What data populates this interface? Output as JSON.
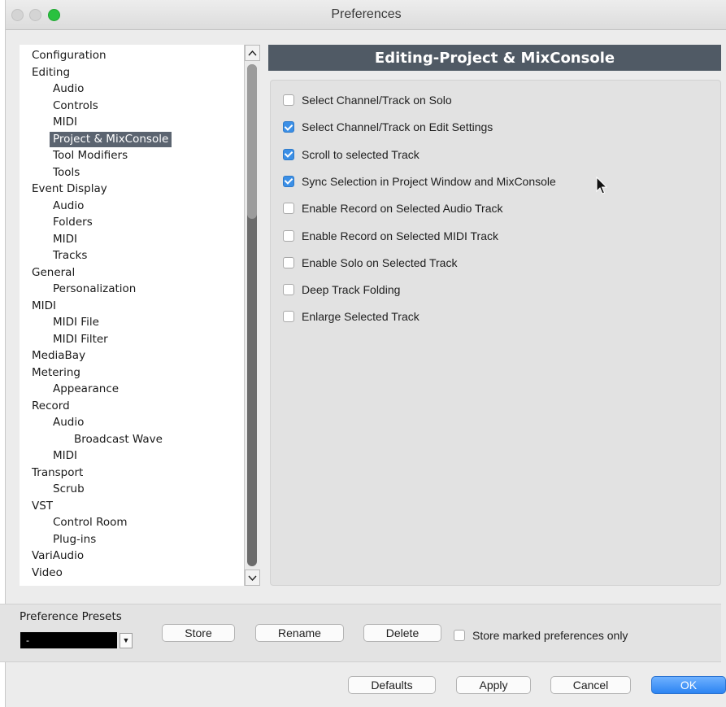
{
  "window": {
    "title": "Preferences"
  },
  "tree": {
    "items": [
      {
        "label": "Configuration",
        "level": 0
      },
      {
        "label": "Editing",
        "level": 0
      },
      {
        "label": "Audio",
        "level": 1
      },
      {
        "label": "Controls",
        "level": 1
      },
      {
        "label": "MIDI",
        "level": 1
      },
      {
        "label": "Project & MixConsole",
        "level": 1,
        "selected": true
      },
      {
        "label": "Tool Modifiers",
        "level": 1
      },
      {
        "label": "Tools",
        "level": 1
      },
      {
        "label": "Event Display",
        "level": 0
      },
      {
        "label": "Audio",
        "level": 1
      },
      {
        "label": "Folders",
        "level": 1
      },
      {
        "label": "MIDI",
        "level": 1
      },
      {
        "label": "Tracks",
        "level": 1
      },
      {
        "label": "General",
        "level": 0
      },
      {
        "label": "Personalization",
        "level": 1
      },
      {
        "label": "MIDI",
        "level": 0
      },
      {
        "label": "MIDI File",
        "level": 1
      },
      {
        "label": "MIDI Filter",
        "level": 1
      },
      {
        "label": "MediaBay",
        "level": 0
      },
      {
        "label": "Metering",
        "level": 0
      },
      {
        "label": "Appearance",
        "level": 1
      },
      {
        "label": "Record",
        "level": 0
      },
      {
        "label": "Audio",
        "level": 1
      },
      {
        "label": "Broadcast Wave",
        "level": 2
      },
      {
        "label": "MIDI",
        "level": 1
      },
      {
        "label": "Transport",
        "level": 0
      },
      {
        "label": "Scrub",
        "level": 1
      },
      {
        "label": "VST",
        "level": 0
      },
      {
        "label": "Control Room",
        "level": 1
      },
      {
        "label": "Plug-ins",
        "level": 1
      },
      {
        "label": "VariAudio",
        "level": 0
      },
      {
        "label": "Video",
        "level": 0
      }
    ]
  },
  "panel": {
    "title": "Editing-Project & MixConsole",
    "options": [
      {
        "label": "Select Channel/Track on Solo",
        "checked": false
      },
      {
        "label": "Select Channel/Track on Edit Settings",
        "checked": true
      },
      {
        "label": "Scroll to selected Track",
        "checked": true
      },
      {
        "label": "Sync Selection in Project Window and MixConsole",
        "checked": true
      },
      {
        "label": "Enable Record on Selected Audio Track",
        "checked": false
      },
      {
        "label": "Enable Record on Selected MIDI Track",
        "checked": false
      },
      {
        "label": "Enable Solo on Selected Track",
        "checked": false
      },
      {
        "label": "Deep Track Folding",
        "checked": false
      },
      {
        "label": "Enlarge Selected Track",
        "checked": false
      }
    ]
  },
  "presets": {
    "label": "Preference Presets",
    "selected_value": "-",
    "store_label": "Store",
    "rename_label": "Rename",
    "delete_label": "Delete",
    "store_marked_label": "Store marked preferences only",
    "store_marked_checked": false
  },
  "footer": {
    "defaults_label": "Defaults",
    "apply_label": "Apply",
    "cancel_label": "Cancel",
    "ok_label": "OK"
  },
  "colors": {
    "accent": "#3b8fe6",
    "selection": "#5b6470",
    "header": "#505a65",
    "close_button": "#29c13f"
  }
}
